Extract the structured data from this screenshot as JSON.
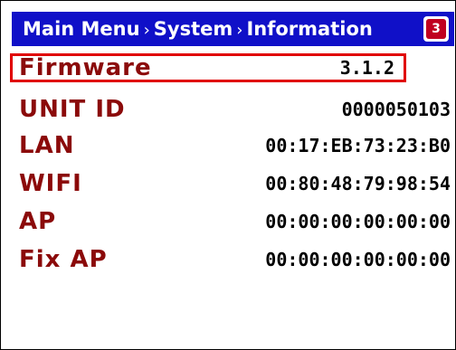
{
  "header": {
    "crumbs": [
      "Main Menu",
      "System",
      "Information"
    ],
    "separator": "›",
    "logo_text": "3",
    "logo_icon": "l3-logo-icon",
    "background_color": "#1010c8"
  },
  "info_rows": [
    {
      "label": "Firmware",
      "value": "3.1.2",
      "selected": true
    },
    {
      "label": "UNIT ID",
      "value": "0000050103"
    },
    {
      "label": "LAN",
      "value": "00:17:EB:73:23:B0"
    },
    {
      "label": "WIFI",
      "value": "00:80:48:79:98:54"
    },
    {
      "label": "AP",
      "value": "00:00:00:00:00:00"
    },
    {
      "label": "Fix AP",
      "value": "00:00:00:00:00:00"
    }
  ],
  "colors": {
    "label": "#8b0a0a",
    "selection_border": "#e00000"
  }
}
